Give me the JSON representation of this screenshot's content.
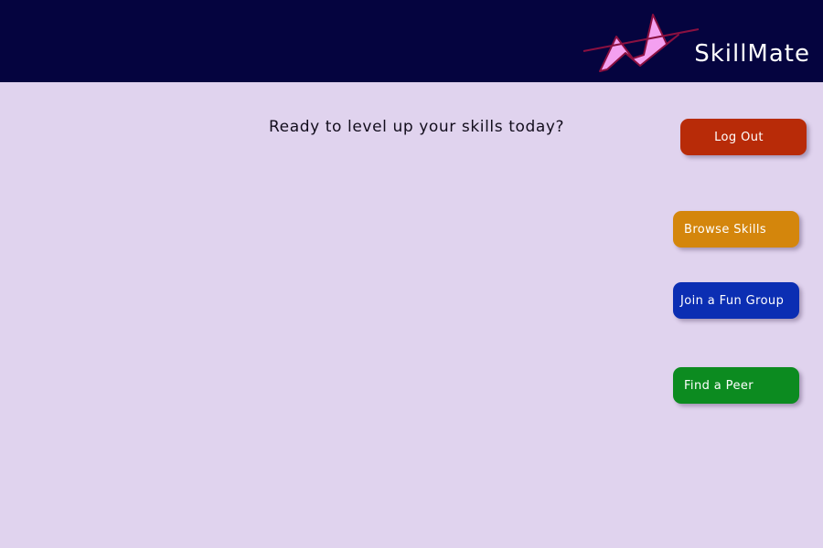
{
  "header": {
    "brand_name": "SkillMate",
    "logo_icon": "skillmate-logo-icon",
    "background": "#05043f"
  },
  "main": {
    "greeting": "Ready to level up your skills today?",
    "background": "#e0d3ee"
  },
  "actions": {
    "logout_label": "Log Out",
    "browse_label": "Browse Skills",
    "group_label": "Join a Fun Group",
    "peer_label": "Find a Peer"
  },
  "colors": {
    "logout": "#b82b08",
    "browse": "#d4860c",
    "group": "#0b2eb3",
    "peer": "#0c8b20",
    "logo_fill": "#f4a0f0",
    "logo_stroke": "#8a1040"
  }
}
